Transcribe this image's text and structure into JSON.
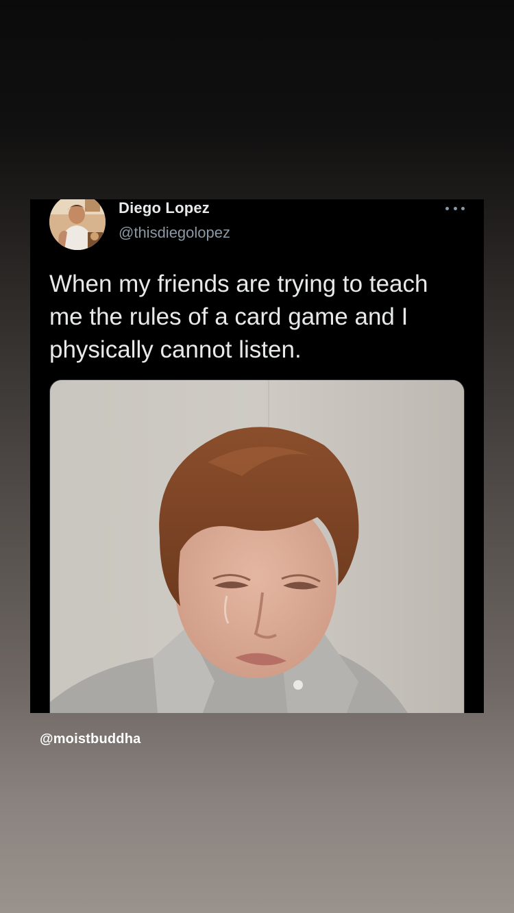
{
  "tweet": {
    "display_name": "Diego Lopez",
    "handle": "@thisdiegolopez",
    "text": "When my friends are trying to teach me the rules of a card game and I physically cannot listen.",
    "more_icon": "more-horizontal-icon",
    "avatar_icon": "user-avatar",
    "media_subject": "photo-of-crying-person"
  },
  "story": {
    "mention": "@moistbuddha"
  },
  "colors": {
    "card_bg": "#000000",
    "primary_text": "#e7e9ea",
    "secondary_text": "#8b98a5",
    "mention_text": "#ffffff"
  }
}
